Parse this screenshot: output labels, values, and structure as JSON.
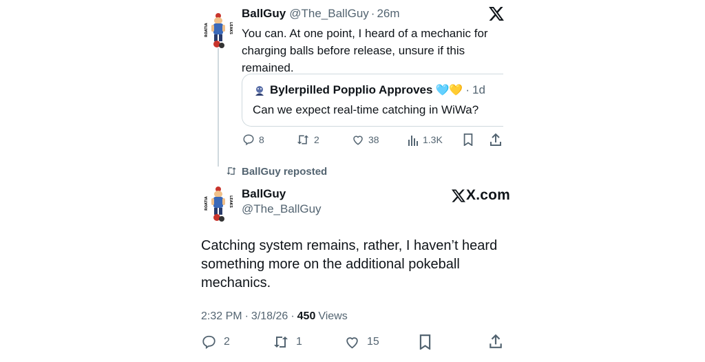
{
  "reply_tweet": {
    "display_name": "BallGuy",
    "handle": "@The_BallGuy",
    "separator": "·",
    "time_ago": "26m",
    "text": "You can. At one point, I heard of a mechanic for charging balls before release, unsure if this remained.",
    "quote": {
      "display_name": "Bylerpilled Popplio Approves",
      "emoji": "🩵💛",
      "separator": "·",
      "time_ago": "1d",
      "text": "Can we expect real-time catching in WiWa?"
    },
    "actions": {
      "replies": "8",
      "reposts": "2",
      "likes": "38",
      "views": "1.3K"
    }
  },
  "repost_banner": "BallGuy reposted",
  "main_tweet": {
    "display_name": "BallGuy",
    "handle": "@The_BallGuy",
    "brand": "X.com",
    "text": "Catching system remains, rather, I haven’t heard something more on the additional pokeball mechanics.",
    "time": "2:32 PM",
    "sep1": "·",
    "date": "3/18/26",
    "sep2": "·",
    "views_count": "450",
    "views_label": "Views",
    "actions": {
      "replies": "2",
      "reposts": "1",
      "likes": "15"
    }
  },
  "avatar_text": {
    "left": "ROATIA",
    "right": "LEAKS"
  },
  "icons": [
    "x-logo-icon",
    "reply-icon",
    "repost-icon",
    "like-icon",
    "views-icon",
    "bookmark-icon",
    "share-icon"
  ],
  "colors": {
    "text": "#0f1419",
    "muted": "#536471",
    "border": "#cfd9de",
    "thread_line": "#cfd9de"
  }
}
